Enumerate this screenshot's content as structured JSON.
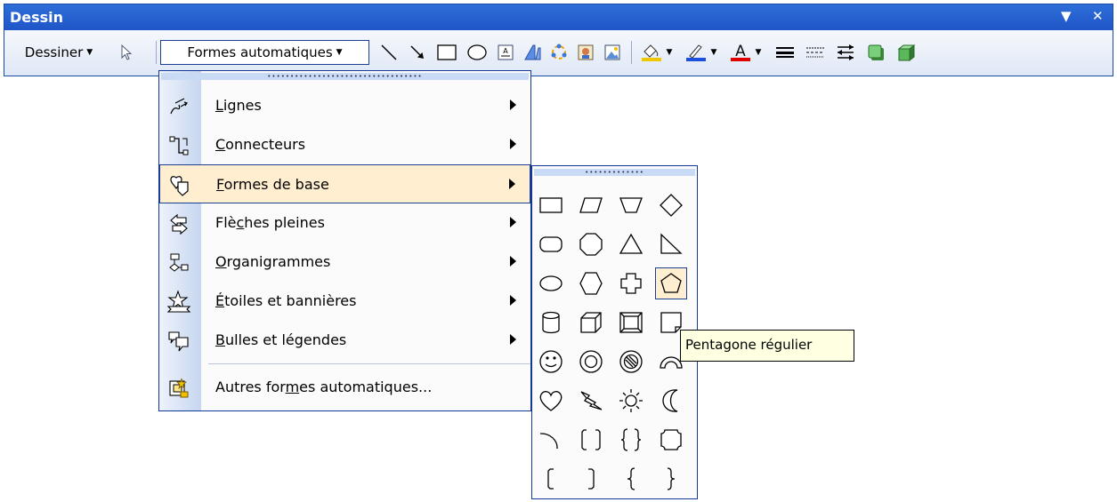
{
  "window": {
    "title": "Dessin",
    "menu_glyph": "▼",
    "close_glyph": "✕"
  },
  "toolbar": {
    "dessiner_label": "Dessiner",
    "autoshapes_label": "Formes automatiques",
    "icons": [
      "select-arrow-icon",
      "line-icon",
      "arrow-icon",
      "rectangle-icon",
      "oval-icon",
      "textbox-icon",
      "wordart-icon",
      "diagram-icon",
      "clipart-icon",
      "picture-icon",
      "fill-color-icon",
      "line-color-icon",
      "font-color-icon",
      "line-style-icon",
      "dash-style-icon",
      "arrow-style-icon",
      "shadow-icon",
      "3d-icon"
    ],
    "colors": {
      "fill": "#f0c800",
      "line": "#1e50e0",
      "font": "#e00000"
    }
  },
  "autoshapes_menu": {
    "items": [
      {
        "label": "Lignes",
        "accel": "L",
        "icon": "lines-icon",
        "submenu": true
      },
      {
        "label": "Connecteurs",
        "accel": "C",
        "icon": "connectors-icon",
        "submenu": true
      },
      {
        "label": "Formes de base",
        "accel": "F",
        "icon": "basic-shapes-icon",
        "submenu": true,
        "highlighted": true
      },
      {
        "label": "Flèches pleines",
        "accel": "c",
        "icon": "block-arrows-icon",
        "submenu": true
      },
      {
        "label": "Organigrammes",
        "accel": "O",
        "icon": "flowchart-icon",
        "submenu": true
      },
      {
        "label": "Étoiles et bannières",
        "accel": "É",
        "icon": "stars-banners-icon",
        "submenu": true
      },
      {
        "label": "Bulles et légendes",
        "accel": "B",
        "icon": "callouts-icon",
        "submenu": true
      },
      {
        "label": "Autres formes automatiques...",
        "accel": "m",
        "icon": "more-autoshapes-icon",
        "submenu": false
      }
    ]
  },
  "basic_shapes": {
    "shapes": [
      "rectangle",
      "parallelogram",
      "trapezoid",
      "diamond",
      "rounded-rectangle",
      "octagon",
      "isosceles-triangle",
      "right-triangle",
      "oval",
      "hexagon",
      "cross",
      "regular-pentagon",
      "can",
      "cube",
      "bevel",
      "folded-corner",
      "smiley-face",
      "donut",
      "no-symbol",
      "block-arc",
      "heart",
      "lightning-bolt",
      "sun",
      "moon",
      "arc",
      "double-bracket",
      "double-brace",
      "plaque",
      "left-bracket",
      "right-bracket",
      "left-brace",
      "right-brace"
    ],
    "selected": "regular-pentagon"
  },
  "tooltip": {
    "text": "Pentagone régulier"
  }
}
